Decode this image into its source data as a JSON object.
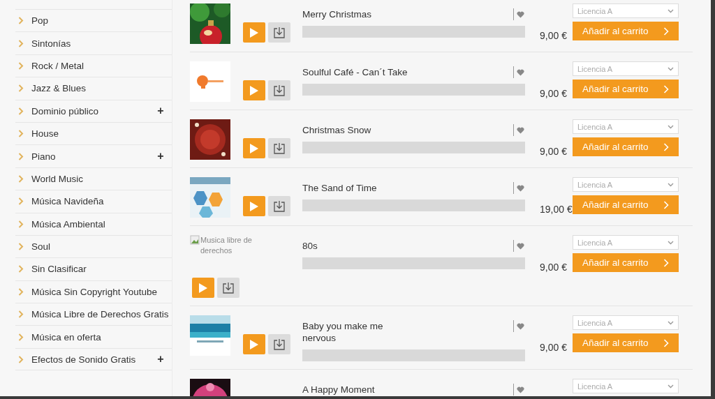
{
  "sidebar": {
    "items": [
      {
        "label": "Pop"
      },
      {
        "label": "Sintonías"
      },
      {
        "label": "Rock / Metal"
      },
      {
        "label": "Jazz & Blues"
      },
      {
        "label": "Dominio público",
        "toggle": "+"
      },
      {
        "label": "House"
      },
      {
        "label": "Piano",
        "toggle": "+"
      },
      {
        "label": "World Music"
      },
      {
        "label": "Música Navideña"
      },
      {
        "label": "Música Ambiental"
      },
      {
        "label": "Soul"
      },
      {
        "label": "Sin Clasificar"
      },
      {
        "label": "Música Sin Copyright Youtube"
      },
      {
        "label": "Música Libre de Derechos Gratis"
      },
      {
        "label": "Música en oferta"
      },
      {
        "label": "Efectos de Sonido Gratis",
        "toggle": "+"
      }
    ]
  },
  "tracks": [
    {
      "kind": "full",
      "title": "Merry Christmas",
      "price": "9,00 €",
      "license": "Licencia A",
      "cart_button": "Añadir al carrito"
    },
    {
      "kind": "full",
      "title": "Soulful Café - Can´t Take",
      "price": "9,00 €",
      "license": "Licencia A",
      "cart_button": "Añadir al carrito"
    },
    {
      "kind": "full",
      "title": "Christmas Snow",
      "price": "9,00 €",
      "license": "Licencia A",
      "cart_button": "Añadir al carrito"
    },
    {
      "kind": "full",
      "title": "The Sand of Time",
      "price": "19,00 €",
      "license": "Licencia A",
      "cart_button": "Añadir al carrito"
    },
    {
      "kind": "full",
      "thumbnail": {
        "kind": "broken",
        "alt": "Musica libre de derechos"
      },
      "title": "80s",
      "price": "9,00 €",
      "license": "Licencia A",
      "cart_button": "Añadir al carrito"
    },
    {
      "kind": "full",
      "title": "Baby you make me\nnervous",
      "price": "9,00 €",
      "license": "Licencia A",
      "cart_button": "Añadir al carrito"
    },
    {
      "kind": "partial",
      "title": "A Happy Moment",
      "license": "Licencia A"
    }
  ]
}
